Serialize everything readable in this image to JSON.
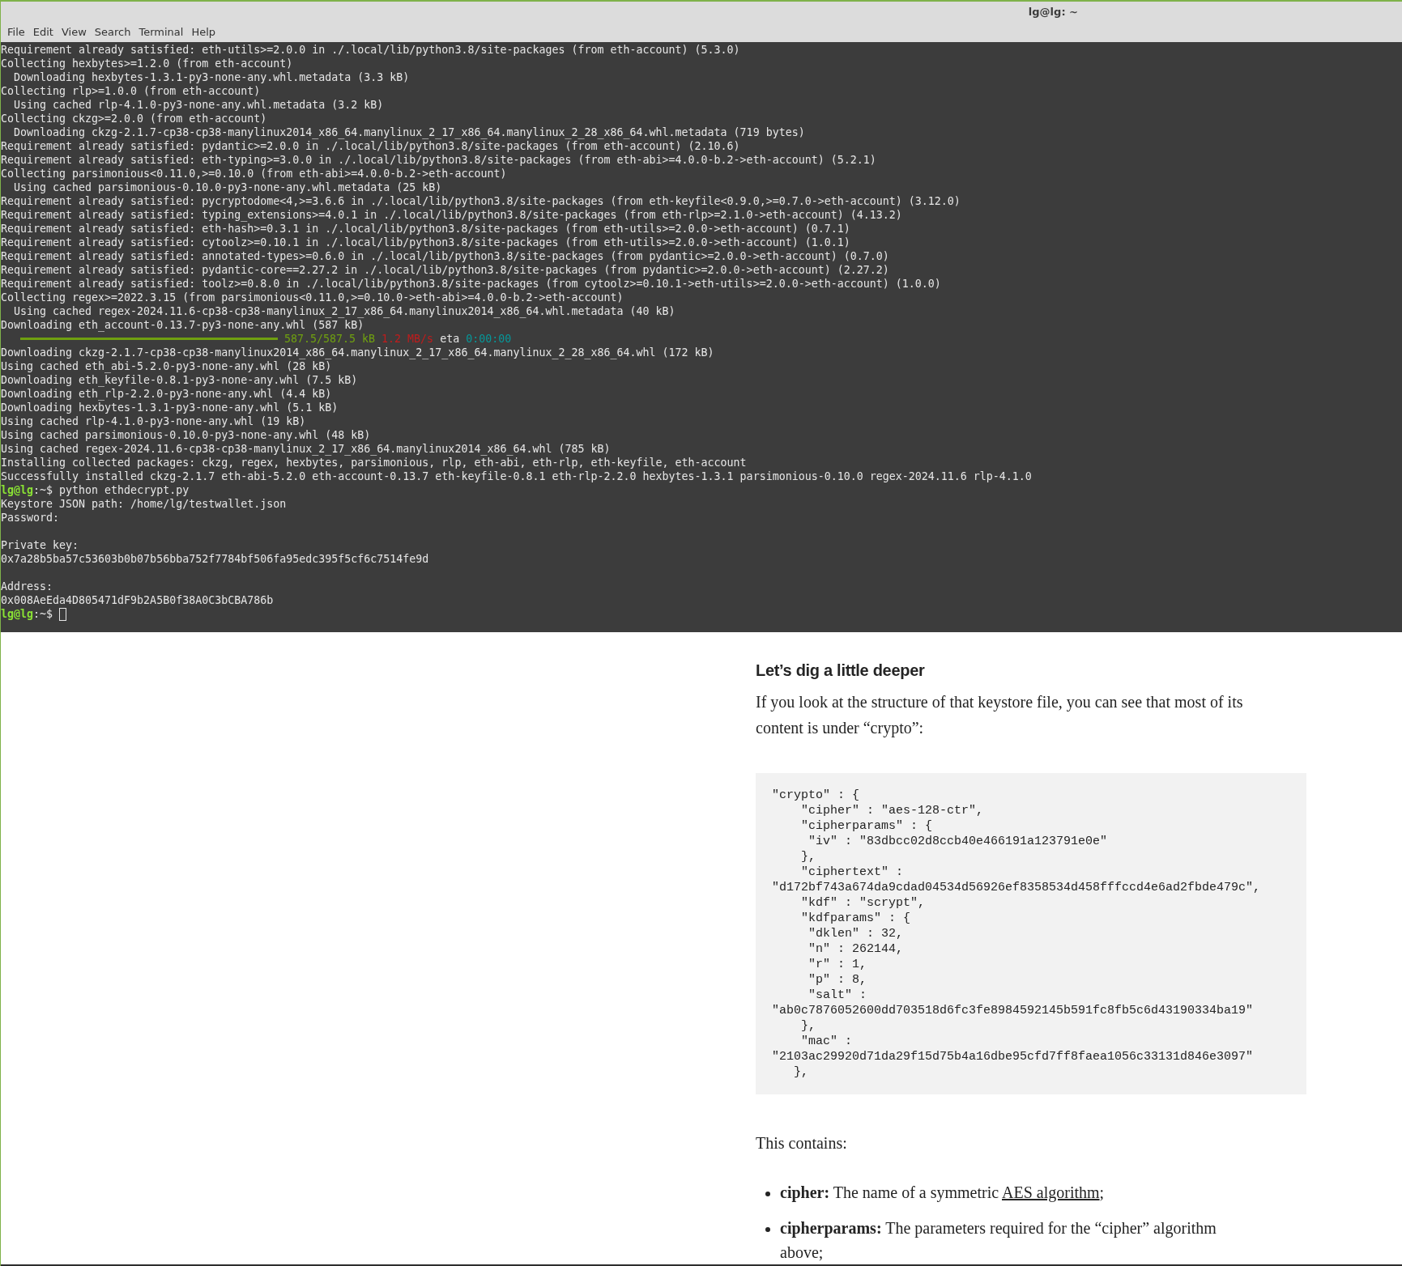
{
  "window": {
    "title": "lg@lg: ~"
  },
  "menu": [
    "File",
    "Edit",
    "View",
    "Search",
    "Terminal",
    "Help"
  ],
  "terminal": {
    "lines": [
      {
        "kind": "text",
        "text": "Requirement already satisfied: eth-utils>=2.0.0 in ./.local/lib/python3.8/site-packages (from eth-account) (5.3.0)"
      },
      {
        "kind": "text",
        "text": "Collecting hexbytes>=1.2.0 (from eth-account)"
      },
      {
        "kind": "text",
        "text": "  Downloading hexbytes-1.3.1-py3-none-any.whl.metadata (3.3 kB)"
      },
      {
        "kind": "text",
        "text": "Collecting rlp>=1.0.0 (from eth-account)"
      },
      {
        "kind": "text",
        "text": "  Using cached rlp-4.1.0-py3-none-any.whl.metadata (3.2 kB)"
      },
      {
        "kind": "text",
        "text": "Collecting ckzg>=2.0.0 (from eth-account)"
      },
      {
        "kind": "text",
        "text": "  Downloading ckzg-2.1.7-cp38-cp38-manylinux2014_x86_64.manylinux_2_17_x86_64.manylinux_2_28_x86_64.whl.metadata (719 bytes)"
      },
      {
        "kind": "text",
        "text": "Requirement already satisfied: pydantic>=2.0.0 in ./.local/lib/python3.8/site-packages (from eth-account) (2.10.6)"
      },
      {
        "kind": "text",
        "text": "Requirement already satisfied: eth-typing>=3.0.0 in ./.local/lib/python3.8/site-packages (from eth-abi>=4.0.0-b.2->eth-account) (5.2.1)"
      },
      {
        "kind": "text",
        "text": "Collecting parsimonious<0.11.0,>=0.10.0 (from eth-abi>=4.0.0-b.2->eth-account)"
      },
      {
        "kind": "text",
        "text": "  Using cached parsimonious-0.10.0-py3-none-any.whl.metadata (25 kB)"
      },
      {
        "kind": "text",
        "text": "Requirement already satisfied: pycryptodome<4,>=3.6.6 in ./.local/lib/python3.8/site-packages (from eth-keyfile<0.9.0,>=0.7.0->eth-account) (3.12.0)"
      },
      {
        "kind": "text",
        "text": "Requirement already satisfied: typing_extensions>=4.0.1 in ./.local/lib/python3.8/site-packages (from eth-rlp>=2.1.0->eth-account) (4.13.2)"
      },
      {
        "kind": "text",
        "text": "Requirement already satisfied: eth-hash>=0.3.1 in ./.local/lib/python3.8/site-packages (from eth-utils>=2.0.0->eth-account) (0.7.1)"
      },
      {
        "kind": "text",
        "text": "Requirement already satisfied: cytoolz>=0.10.1 in ./.local/lib/python3.8/site-packages (from eth-utils>=2.0.0->eth-account) (1.0.1)"
      },
      {
        "kind": "text",
        "text": "Requirement already satisfied: annotated-types>=0.6.0 in ./.local/lib/python3.8/site-packages (from pydantic>=2.0.0->eth-account) (0.7.0)"
      },
      {
        "kind": "text",
        "text": "Requirement already satisfied: pydantic-core==2.27.2 in ./.local/lib/python3.8/site-packages (from pydantic>=2.0.0->eth-account) (2.27.2)"
      },
      {
        "kind": "text",
        "text": "Requirement already satisfied: toolz>=0.8.0 in ./.local/lib/python3.8/site-packages (from cytoolz>=0.10.1->eth-utils>=2.0.0->eth-account) (1.0.0)"
      },
      {
        "kind": "text",
        "text": "Collecting regex>=2022.3.15 (from parsimonious<0.11.0,>=0.10.0->eth-abi>=4.0.0-b.2->eth-account)"
      },
      {
        "kind": "text",
        "text": "  Using cached regex-2024.11.6-cp38-cp38-manylinux_2_17_x86_64.manylinux2014_x86_64.whl.metadata (40 kB)"
      },
      {
        "kind": "text",
        "text": "Downloading eth_account-0.13.7-py3-none-any.whl (587 kB)"
      },
      {
        "kind": "progress",
        "level": 1,
        "size": "587.5/587.5 kB",
        "speed": "1.2 MB/s",
        "eta_label": "eta",
        "eta": "0:00:00"
      },
      {
        "kind": "text",
        "text": "Downloading ckzg-2.1.7-cp38-cp38-manylinux2014_x86_64.manylinux_2_17_x86_64.manylinux_2_28_x86_64.whl (172 kB)"
      },
      {
        "kind": "text",
        "text": "Using cached eth_abi-5.2.0-py3-none-any.whl (28 kB)"
      },
      {
        "kind": "text",
        "text": "Downloading eth_keyfile-0.8.1-py3-none-any.whl (7.5 kB)"
      },
      {
        "kind": "text",
        "text": "Downloading eth_rlp-2.2.0-py3-none-any.whl (4.4 kB)"
      },
      {
        "kind": "text",
        "text": "Downloading hexbytes-1.3.1-py3-none-any.whl (5.1 kB)"
      },
      {
        "kind": "text",
        "text": "Using cached rlp-4.1.0-py3-none-any.whl (19 kB)"
      },
      {
        "kind": "text",
        "text": "Using cached parsimonious-0.10.0-py3-none-any.whl (48 kB)"
      },
      {
        "kind": "text",
        "text": "Using cached regex-2024.11.6-cp38-cp38-manylinux_2_17_x86_64.manylinux2014_x86_64.whl (785 kB)"
      },
      {
        "kind": "text",
        "text": "Installing collected packages: ckzg, regex, hexbytes, parsimonious, rlp, eth-abi, eth-rlp, eth-keyfile, eth-account"
      },
      {
        "kind": "text",
        "text": "Successfully installed ckzg-2.1.7 eth-abi-5.2.0 eth-account-0.13.7 eth-keyfile-0.8.1 eth-rlp-2.2.0 hexbytes-1.3.1 parsimonious-0.10.0 regex-2024.11.6 rlp-4.1.0"
      },
      {
        "kind": "prompt",
        "user": "lg@lg",
        "path": ":~$",
        "command": "python ethdecrypt.py",
        "cursor": false
      },
      {
        "kind": "text",
        "text": "Keystore JSON path: /home/lg/testwallet.json"
      },
      {
        "kind": "text",
        "text": "Password:"
      },
      {
        "kind": "blank"
      },
      {
        "kind": "text",
        "text": "Private key:"
      },
      {
        "kind": "text",
        "text": "0x7a28b5ba57c53603b0b07b56bba752f7784bf506fa95edc395f5cf6c7514fe9d"
      },
      {
        "kind": "blank"
      },
      {
        "kind": "text",
        "text": "Address:"
      },
      {
        "kind": "text",
        "text": "0x008AeEda4D805471dF9b2A5B0f38A0C3bCBA786b"
      },
      {
        "kind": "prompt",
        "user": "lg@lg",
        "path": ":~$",
        "cursor": true
      }
    ]
  },
  "article": {
    "heading": "Let’s dig a little deeper",
    "intro": "If you look at the structure of that keystore file, you can see that most of its content is under “crypto”:",
    "code": "\"crypto\" : {\n    \"cipher\" : \"aes-128-ctr\",\n    \"cipherparams\" : {\n     \"iv\" : \"83dbcc02d8ccb40e466191a123791e0e\"\n    },\n    \"ciphertext\" :\n\"d172bf743a674da9cdad04534d56926ef8358534d458fffccd4e6ad2fbde479c\",\n    \"kdf\" : \"scrypt\",\n    \"kdfparams\" : {\n     \"dklen\" : 32,\n     \"n\" : 262144,\n     \"r\" : 1,\n     \"p\" : 8,\n     \"salt\" :\n\"ab0c7876052600dd703518d6fc3fe8984592145b591fc8fb5c6d43190334ba19\"\n    },\n    \"mac\" :\n\"2103ac29920d71da29f15d75b4a16dbe95cfd7ff8faea1056c33131d846e3097\"\n   },",
    "contains": "This contains:",
    "items": [
      {
        "term": "cipher:",
        "text": " The name of a symmetric ",
        "link": "AES algorithm",
        "after": ";"
      },
      {
        "term": "cipherparams:",
        "text": " The parameters required for the “cipher” algorithm above;"
      }
    ]
  }
}
